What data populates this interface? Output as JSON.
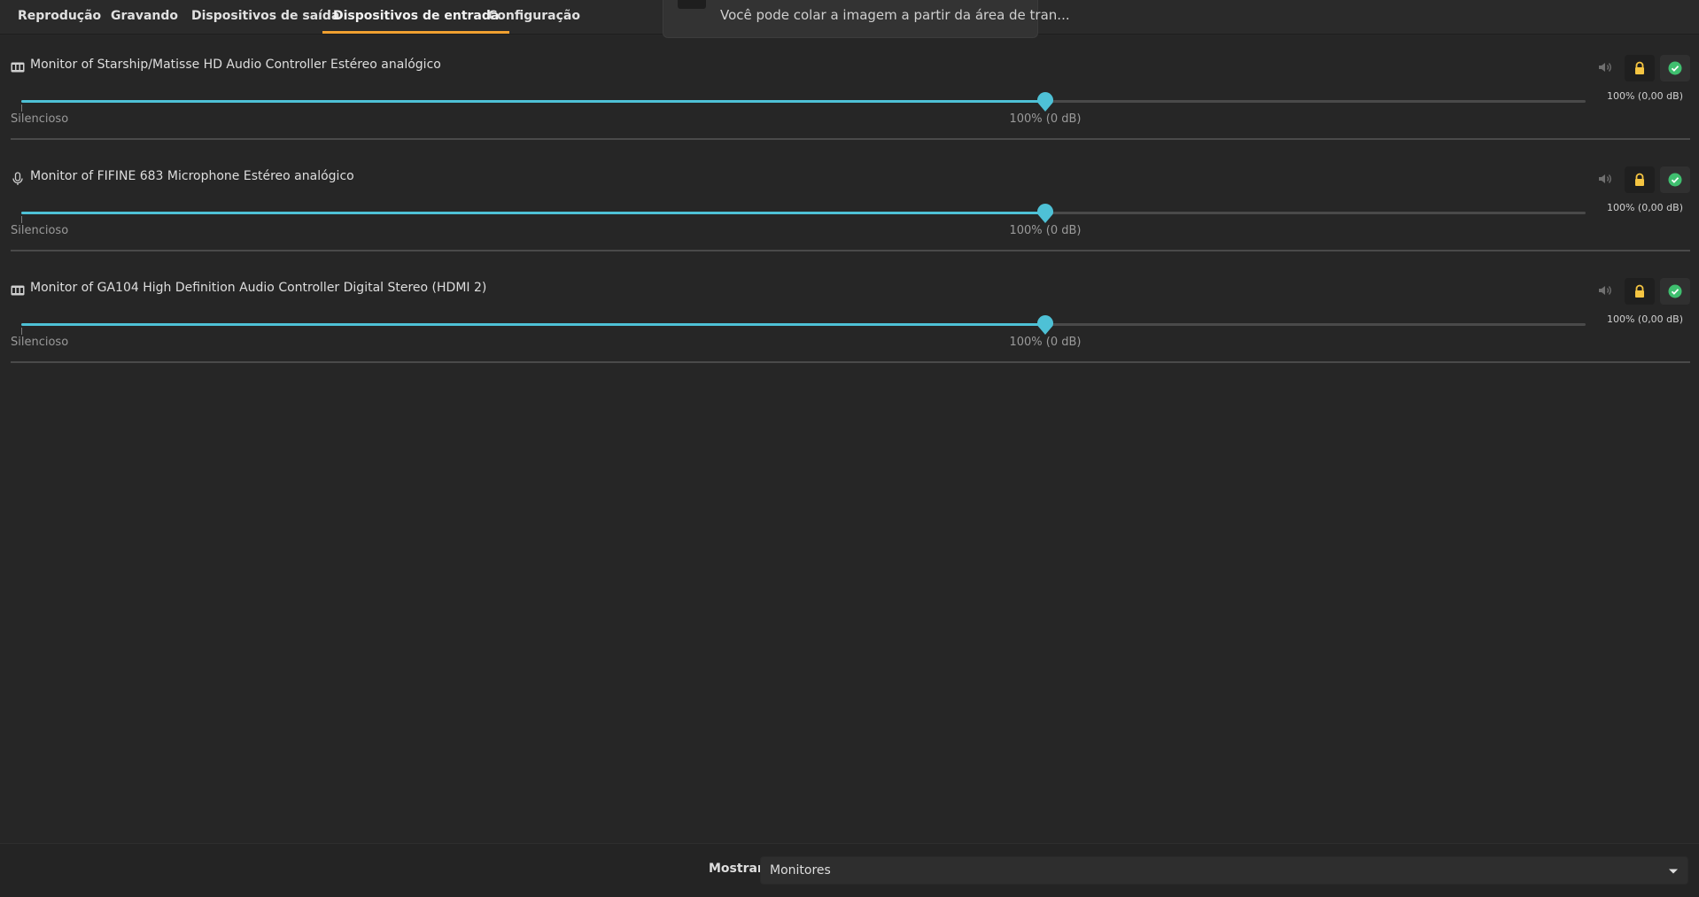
{
  "tabs": [
    {
      "label": "Reprodução"
    },
    {
      "label": "Gravando"
    },
    {
      "label": "Dispositivos de saída"
    },
    {
      "label": "Dispositivos de entrada",
      "active": true
    },
    {
      "label": "Configuração"
    }
  ],
  "notification": {
    "text": "Você pode colar a imagem a partir da área de tran..."
  },
  "devices": [
    {
      "name": "Monitor of Starship/Matisse HD Audio Controller Estéreo analógico",
      "icon": "sound-card-icon",
      "volume_percent": 100,
      "volume_label": "100% (0,00 dB)",
      "silent_label": "Silencioso",
      "mark_100_label": "100% (0 dB)"
    },
    {
      "name": "Monitor of FIFINE 683 Microphone Estéreo analógico",
      "icon": "microphone-icon",
      "volume_percent": 100,
      "volume_label": "100% (0,00 dB)",
      "silent_label": "Silencioso",
      "mark_100_label": "100% (0 dB)"
    },
    {
      "name": "Monitor of GA104 High Definition Audio Controller Digital Stereo (HDMI 2)",
      "icon": "sound-card-icon",
      "volume_percent": 100,
      "volume_label": "100% (0,00 dB)",
      "silent_label": "Silencioso",
      "mark_100_label": "100% (0 dB)"
    }
  ],
  "footer": {
    "show_label": "Mostrar:",
    "show_value": "Monitores"
  },
  "colors": {
    "accent": "#4ec1d6",
    "tab_underline": "#f0a030",
    "lock": "#f5c542",
    "default_check": "#3fbf6f"
  }
}
